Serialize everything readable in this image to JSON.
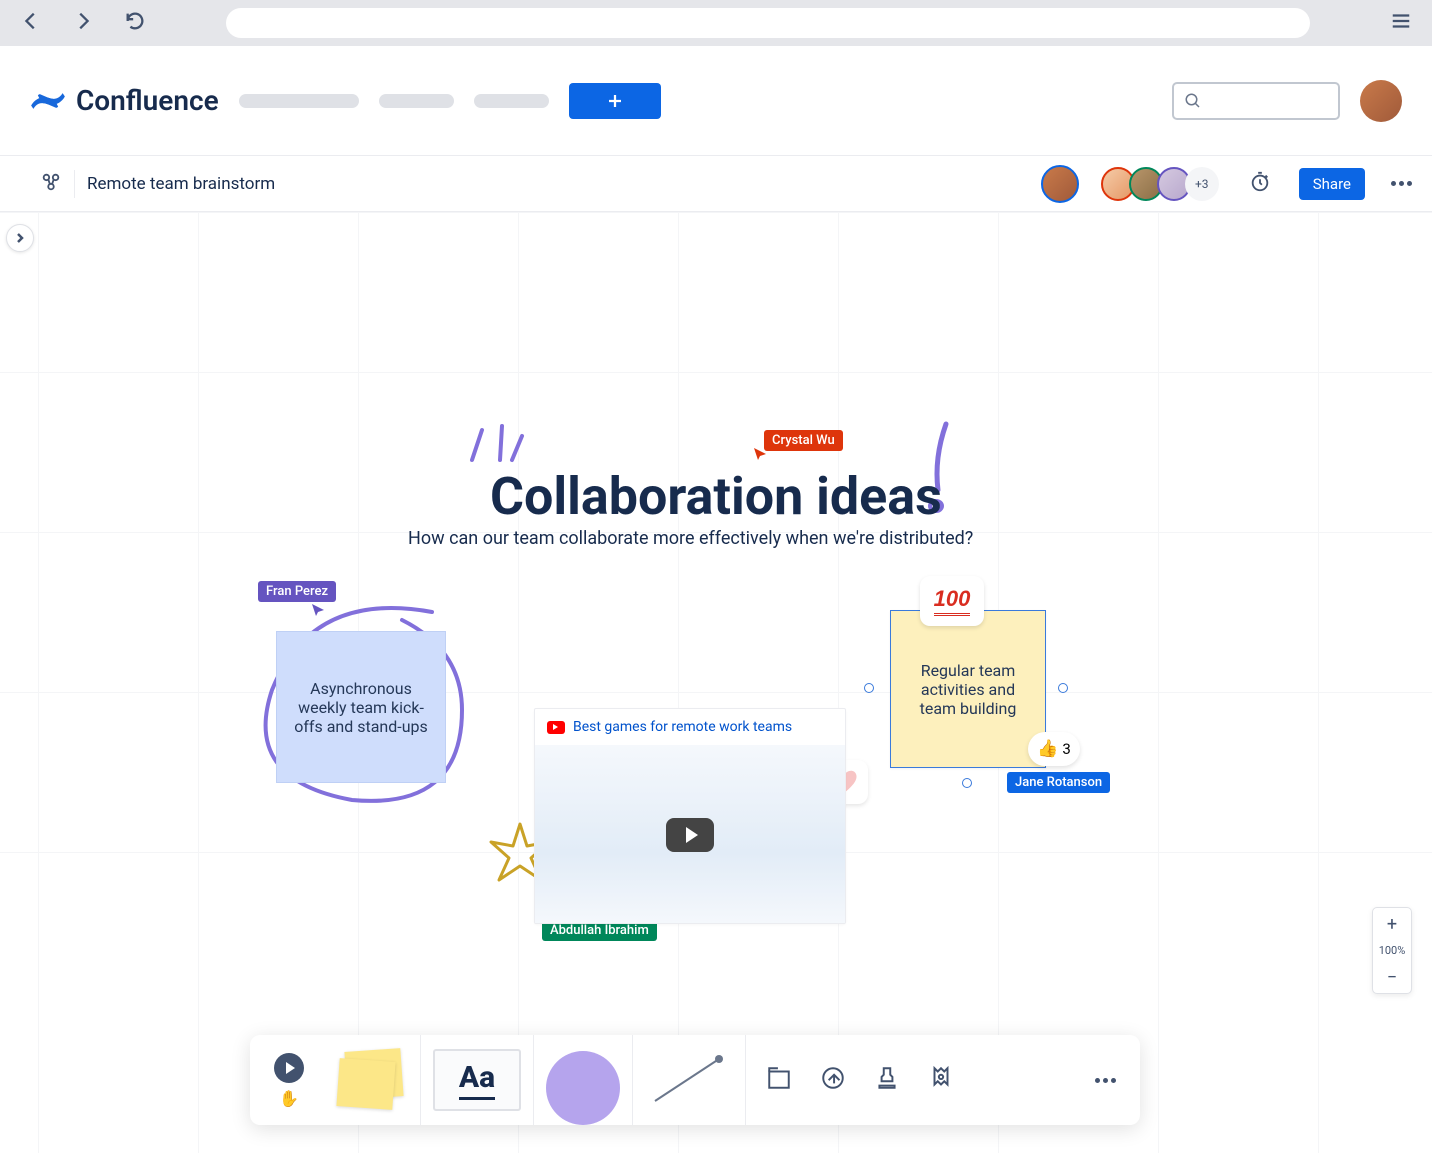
{
  "app": {
    "name": "Confluence"
  },
  "board": {
    "title": "Remote team brainstorm",
    "heading": "Collaboration ideas",
    "subheading": "How can our team collaborate more effectively when we're distributed?"
  },
  "header": {
    "share_label": "Share",
    "presence_overflow": "+3"
  },
  "stickies": {
    "a": "Asynchronous weekly team kick-offs and stand-ups",
    "b": "Regular team activities and team building",
    "hundred": "100"
  },
  "reaction": {
    "emoji": "👍",
    "count": "3"
  },
  "cursors": {
    "red": "Crystal Wu",
    "purple": "Fran Perez",
    "green": "Abdullah Ibrahim",
    "blue": "Jane Rotanson"
  },
  "video": {
    "title": "Best games for remote work teams"
  },
  "toolbar": {
    "text_label": "Aa",
    "hand": "✋"
  },
  "zoom": {
    "plus": "+",
    "level": "100%",
    "minus": "−"
  }
}
